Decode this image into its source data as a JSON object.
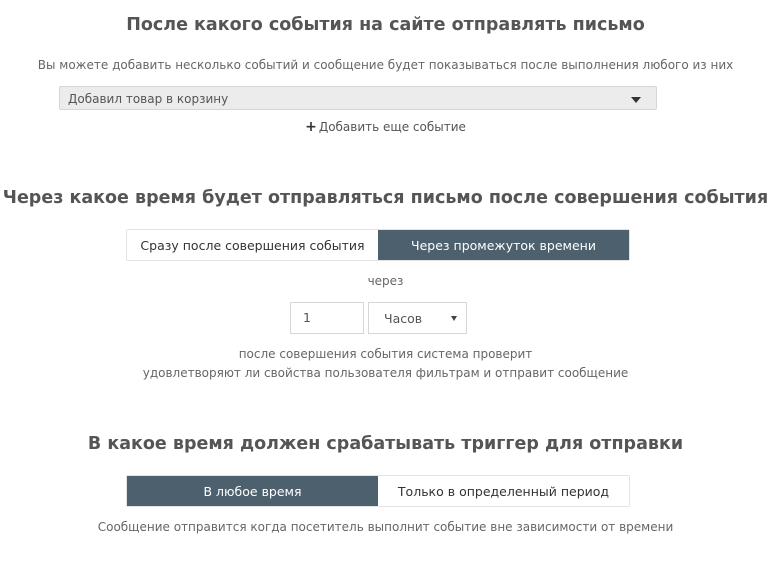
{
  "section1": {
    "title": "После какого события на сайте отправлять письмо",
    "hint": "Вы можете добавить несколько событий и сообщение будет показываться после выполнения любого из них",
    "event_select": {
      "value": "Добавил товар в корзину",
      "icon": "chevron-down-icon"
    },
    "add_event": {
      "icon": "plus-icon",
      "label": "Добавить еще событие"
    }
  },
  "section2": {
    "title": "Через какое время будет отправляться письмо после совершения события",
    "options": [
      "Сразу после совершения события",
      "Через промежуток времени"
    ],
    "active_option": 1,
    "through_label": "через",
    "amount": "1",
    "unit": "Часов",
    "note_line1": "после совершения события система проверит",
    "note_line2": "удовлетворяют ли свойства пользователя фильтрам и отправит сообщение"
  },
  "section3": {
    "title": "В какое время должен срабатывать триггер для отправки",
    "options": [
      "В любое время",
      "Только в определенный период"
    ],
    "active_option": 0,
    "note": "Сообщение отправится когда посетитель выполнит событие вне зависимости от времени"
  },
  "colors": {
    "active_segment": "#4c606d",
    "select_bg": "#ececec",
    "text": "#555555"
  }
}
